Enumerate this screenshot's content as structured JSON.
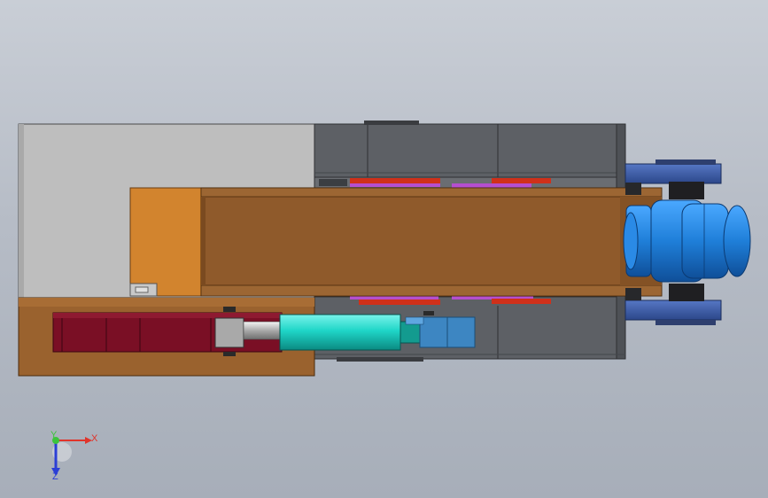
{
  "triad": {
    "x_label": "X",
    "y_label": "Y",
    "z_label": "Z",
    "x_color": "#e0342b",
    "y_color": "#3cc43c",
    "z_color": "#2b3fd6"
  },
  "colors": {
    "background_top": "#c9ced6",
    "background_bottom": "#a7aeb9",
    "gray_plate": "#bdbdbd",
    "dark_steel": "#5b5e63",
    "wood_brown": "#8f5a2b",
    "orange_block": "#d2842e",
    "cylinder_red": "#7a0f25",
    "cylinder_teal": "#1fd6c8",
    "motor_blue": "#1f7fd9",
    "bracket_navy": "#3b5ca8",
    "inner_red": "#d0301a",
    "inner_purple": "#b54fcf"
  }
}
